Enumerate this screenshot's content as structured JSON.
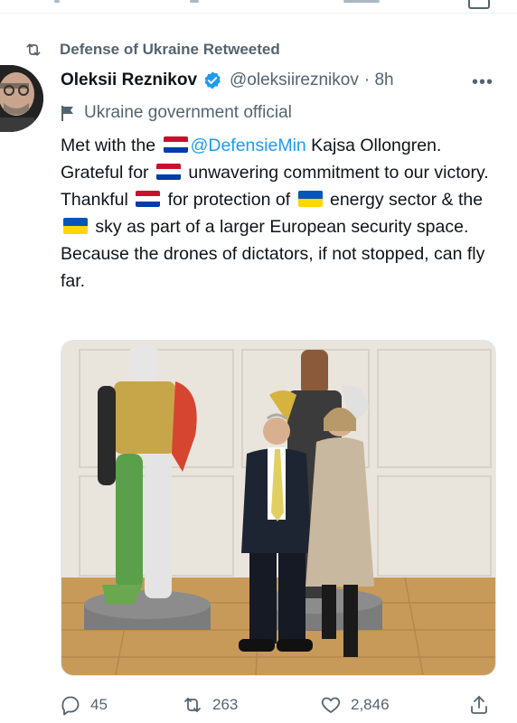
{
  "retweet": {
    "text": "Defense of Ukraine Retweeted",
    "icon": "retweet-icon"
  },
  "author": {
    "name": "Oleksii Reznikov",
    "handle": "@oleksiireznikov",
    "time": "· 8h",
    "verified_icon": "verified-badge-icon",
    "label": "Ukraine government official",
    "label_icon": "flag-icon"
  },
  "tweet": {
    "p1": "Met with the",
    "mention": "@DefensieMin",
    "p2": " Kajsa Ollongren. Grateful for",
    "p3": " unwavering commitment to our victory. Thankful",
    "p4": " for protection of",
    "p5": " energy sector & the",
    "p6": " sky as part of a larger European security space. Because the drones of dictators, if not stopped, can fly far."
  },
  "flags": {
    "netherlands": "netherlands-flag",
    "ukraine": "ukraine-flag"
  },
  "colors": {
    "accent": "#1d9bf0",
    "muted": "#536471",
    "text": "#0f1419"
  },
  "actions": {
    "replies": "45",
    "retweets": "263",
    "likes": "2,846"
  }
}
